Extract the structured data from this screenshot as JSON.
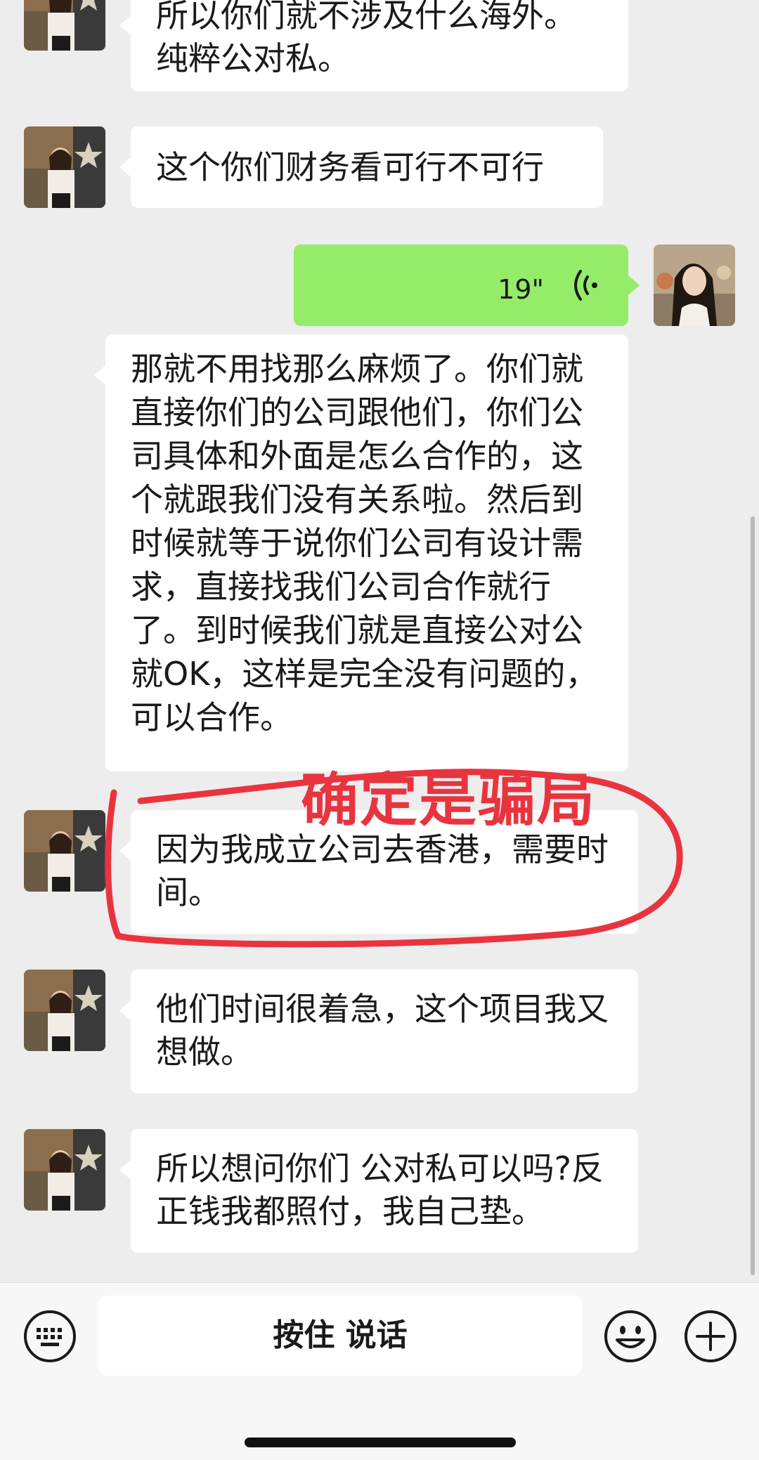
{
  "messages": [
    {
      "side": "left",
      "text": "所以你们就不涉及什么海外。纯粹公对私。"
    },
    {
      "side": "left",
      "text": "这个你们财务看可行不可行"
    },
    {
      "side": "right",
      "type": "voice",
      "duration": "19\""
    },
    {
      "side": "left",
      "text": "那就不用找那么麻烦了。你们就直接你们的公司跟他们，你们公司具体和外面是怎么合作的，这个就跟我们没有关系啦。然后到时候就等于说你们公司有设计需求，直接找我们公司合作就行了。到时候我们就是直接公对公就OK，这样是完全没有问题的，可以合作。"
    },
    {
      "side": "left",
      "text": "因为我成立公司去香港，需要时间。"
    },
    {
      "side": "left",
      "text": "他们时间很着急，这个项目我又想做。"
    },
    {
      "side": "left",
      "text": "所以想问你们 公对私可以吗?反正钱我都照付，我自己垫。"
    }
  ],
  "annotation": {
    "text": "确定是骗局",
    "color": "#e8343f"
  },
  "input_bar": {
    "hold_to_talk": "按住 说话",
    "keyboard_icon": "keyboard-icon",
    "emoji_icon": "emoji-icon",
    "plus_icon": "plus-icon"
  },
  "colors": {
    "background": "#ededed",
    "bubble_in": "#ffffff",
    "bubble_voice": "#95ec69"
  }
}
